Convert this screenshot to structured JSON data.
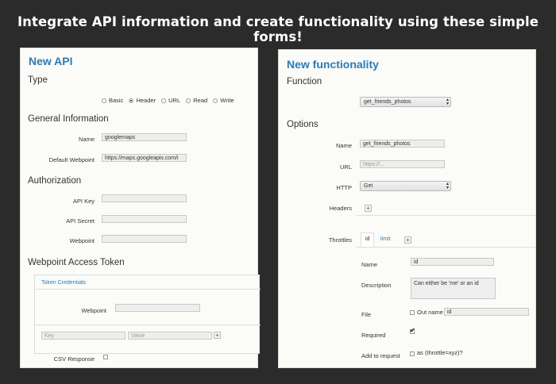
{
  "banner": "Integrate API information and create functionality using these simple forms!",
  "left": {
    "title": "New API",
    "type_section": "Type",
    "type_options": [
      "Basic",
      "Header",
      "URL",
      "Read",
      "Write"
    ],
    "type_selected": "Header",
    "general_section": "General Information",
    "name_label": "Name",
    "name_value": "googlemaps",
    "webpoint_label": "Default Webpoint",
    "webpoint_value": "https://maps.googleapis.com/i",
    "auth_section": "Authorization",
    "api_key_label": "API Key",
    "api_secret_label": "API Secret",
    "auth_webpoint_label": "Webpoint",
    "token_section": "Webpoint Access Token",
    "token_tab": "Token Credentials",
    "token_webpoint_label": "Webpoint",
    "key_placeholder": "Key",
    "value_placeholder": "Value",
    "plus": "+",
    "csv_label": "CSV Response"
  },
  "right": {
    "title": "New functionality",
    "function_section": "Function",
    "function_select": "get_friends_photos",
    "options_section": "Options",
    "name_label": "Name",
    "name_value": "get_friends_photos",
    "url_label": "URL",
    "url_placeholder": "https://...",
    "http_label": "HTTP",
    "http_select": "Get",
    "headers_label": "Headers",
    "plus": "+",
    "throttles_label": "Throttles",
    "tabs": [
      "id",
      "limit"
    ],
    "t_name_label": "Name",
    "t_name_value": "id",
    "t_desc_label": "Description",
    "t_desc_value": "Can either be 'me' or an id",
    "t_file_label": "File",
    "t_outname_label": "Out name",
    "t_outname_value": "id",
    "t_required_label": "Required",
    "t_required_checked": true,
    "t_add_label": "Add to request",
    "t_add_text": "as (throttle=xyz)?"
  },
  "colors": {
    "background": "#2b2b2b",
    "panel": "#fbfbf7",
    "accent": "#2b7bb9"
  }
}
